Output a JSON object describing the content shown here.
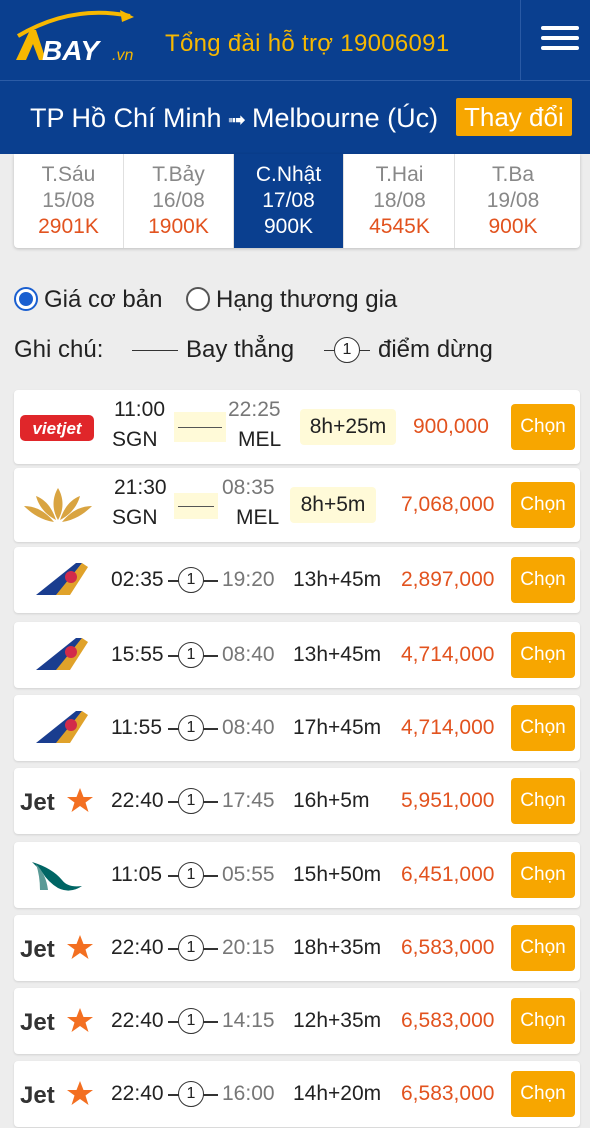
{
  "header": {
    "logo_text": "BAY",
    "logo_suffix": ".vn",
    "hotline": "Tổng đài hỗ trợ 19006091",
    "menu_icon": "hamburger-icon"
  },
  "route": {
    "origin": "TP Hồ Chí Minh",
    "arrow": "➟",
    "destination": "Melbourne (Úc)",
    "change_label": "Thay đổi"
  },
  "dates": [
    {
      "day": "T.Sáu",
      "date": "15/08",
      "price": "2901K"
    },
    {
      "day": "T.Bảy",
      "date": "16/08",
      "price": "1900K"
    },
    {
      "day": "C.Nhật",
      "date": "17/08",
      "price": "900K",
      "active": true
    },
    {
      "day": "T.Hai",
      "date": "18/08",
      "price": "4545K"
    },
    {
      "day": "T.Ba",
      "date": "19/08",
      "price": "900K"
    }
  ],
  "fare_options": {
    "basic": "Giá cơ bản",
    "business": "Hạng thương gia",
    "selected": "basic"
  },
  "legend": {
    "label": "Ghi chú:",
    "direct": "Bay thẳng",
    "stop_number": "1",
    "stop_text": "điểm dừng"
  },
  "flights": [
    {
      "airline": "vietjet",
      "logo_text": "vietjet",
      "dep": "11:00",
      "arr": "22:25",
      "from": "SGN",
      "to": "MEL",
      "stops": 0,
      "duration": "8h+25m",
      "price": "900,000",
      "button": "Chọn"
    },
    {
      "airline": "vietnam-airlines",
      "dep": "21:30",
      "arr": "08:35",
      "from": "SGN",
      "to": "MEL",
      "stops": 0,
      "duration": "8h+5m",
      "price": "7,068,000",
      "button": "Chọn"
    },
    {
      "airline": "china-airlines",
      "dep": "02:35",
      "arr": "19:20",
      "stops": 1,
      "duration": "13h+45m",
      "price": "2,897,000",
      "button": "Chọn"
    },
    {
      "airline": "china-airlines",
      "dep": "15:55",
      "arr": "08:40",
      "stops": 1,
      "duration": "13h+45m",
      "price": "4,714,000",
      "button": "Chọn"
    },
    {
      "airline": "china-airlines",
      "dep": "11:55",
      "arr": "08:40",
      "stops": 1,
      "duration": "17h+45m",
      "price": "4,714,000",
      "button": "Chọn"
    },
    {
      "airline": "jetstar",
      "logo_text": "Jet",
      "dep": "22:40",
      "arr": "17:45",
      "stops": 1,
      "duration": "16h+5m",
      "price": "5,951,000",
      "button": "Chọn"
    },
    {
      "airline": "cathay-pacific",
      "dep": "11:05",
      "arr": "05:55",
      "stops": 1,
      "duration": "15h+50m",
      "price": "6,451,000",
      "button": "Chọn"
    },
    {
      "airline": "jetstar",
      "logo_text": "Jet",
      "dep": "22:40",
      "arr": "20:15",
      "stops": 1,
      "duration": "18h+35m",
      "price": "6,583,000",
      "button": "Chọn"
    },
    {
      "airline": "jetstar",
      "logo_text": "Jet",
      "dep": "22:40",
      "arr": "14:15",
      "stops": 1,
      "duration": "12h+35m",
      "price": "6,583,000",
      "button": "Chọn"
    },
    {
      "airline": "jetstar",
      "logo_text": "Jet",
      "dep": "22:40",
      "arr": "16:00",
      "stops": 1,
      "duration": "14h+20m",
      "price": "6,583,000",
      "button": "Chọn"
    }
  ],
  "colors": {
    "brand_blue": "#0a3f8f",
    "accent_orange": "#f7a600",
    "price_red": "#e2531f",
    "hotline_yellow": "#f7b800"
  }
}
